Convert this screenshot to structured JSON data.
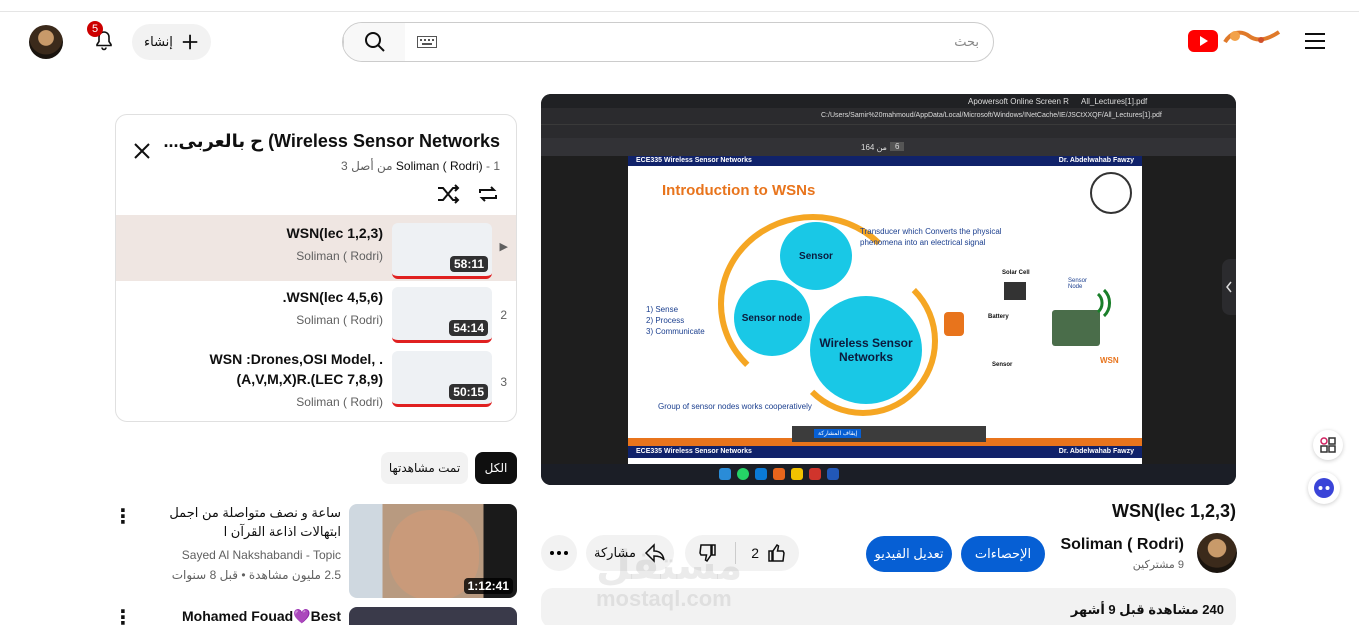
{
  "masthead": {
    "create_label": "إنشاء",
    "notif_count": "5",
    "search_placeholder": "بحث"
  },
  "player": {
    "browser_url": "C:/Users/Samir%20mahmoud/AppData/Local/Microsoft/Windows/INetCache/IE/JSCtXXQF/All_Lectures[1].pdf",
    "tab_1": "Apowersoft Online Screen R",
    "tab_2": "All_Lectures[1].pdf",
    "header_left": "ECE335 Wireless Sensor Networks",
    "header_right": "Dr. Abdelwahab Fawzy",
    "slide_title": "Introduction to WSNs",
    "sensor_label": "Sensor",
    "sensor_node_label": "Sensor node",
    "wsn_label": "Wireless Sensor Networks",
    "transducer_text": "Transducer which Converts the physical phenomena into an electrical signal",
    "list_1": "1)  Sense",
    "list_2": "2)  Process",
    "list_3": "3)  Communicate",
    "group_text": "Group of sensor nodes works cooperatively",
    "solar_label": "Solar Cell",
    "battery_label": "Battery",
    "sensor_node_small": "Sensor Node",
    "sensor_small": "Sensor",
    "wsn_small": "WSN",
    "footer_left": "ECE335 Wireless Sensor Networks",
    "footer_right": "Dr. Abdelwahab Fawzy",
    "share_stop": "إيقاف المشاركة",
    "page_num": "6",
    "page_total": "من 164"
  },
  "video": {
    "title": "WSN(lec 1,2,3)",
    "channel": "Soliman ( Rodri)",
    "subscribers": "9 مشتركين",
    "stats_btn": "الإحصاءات",
    "edit_btn": "تعديل الفيديو",
    "likes": "2",
    "share_label": "مشاركة",
    "views": "240",
    "views_label": "مشاهدة",
    "date": "قبل 9 أشهر"
  },
  "playlist": {
    "title": "...ح بالعربى (Wireless Sensor Networks",
    "channel": "Soliman ( Rodri)",
    "position": "1 من أصل 3",
    "items": [
      {
        "index": "▶",
        "title": "WSN(lec 1,2,3)",
        "channel": "Soliman ( Rodri)",
        "duration": "58:11"
      },
      {
        "index": "2",
        "title": ".WSN(lec 4,5,6)",
        "channel": "Soliman ( Rodri)",
        "duration": "54:14"
      },
      {
        "index": "3",
        "title": "WSN :Drones,OSI Model, .(A,V,M,X)R.(LEC 7,8,9)",
        "channel": "Soliman ( Rodri)",
        "duration": "50:15"
      }
    ]
  },
  "filters": {
    "all": "الكل",
    "watched": "تمت مشاهدتها"
  },
  "recommendations": [
    {
      "title": "ساعة و نصف متواصلة من اجمل ابتهالات اذاعة القرآن ا",
      "channel": "Sayed Al Nakshabandi - Topic",
      "meta": "2.5 مليون مشاهدة • قبل 8 سنوات",
      "duration": "1:12:41"
    },
    {
      "title": "Mohamed Fouad💜Best",
      "channel": "",
      "meta": "",
      "duration": ""
    }
  ],
  "watermark": {
    "ar": "مستقل",
    "en": "mostaql.com"
  }
}
